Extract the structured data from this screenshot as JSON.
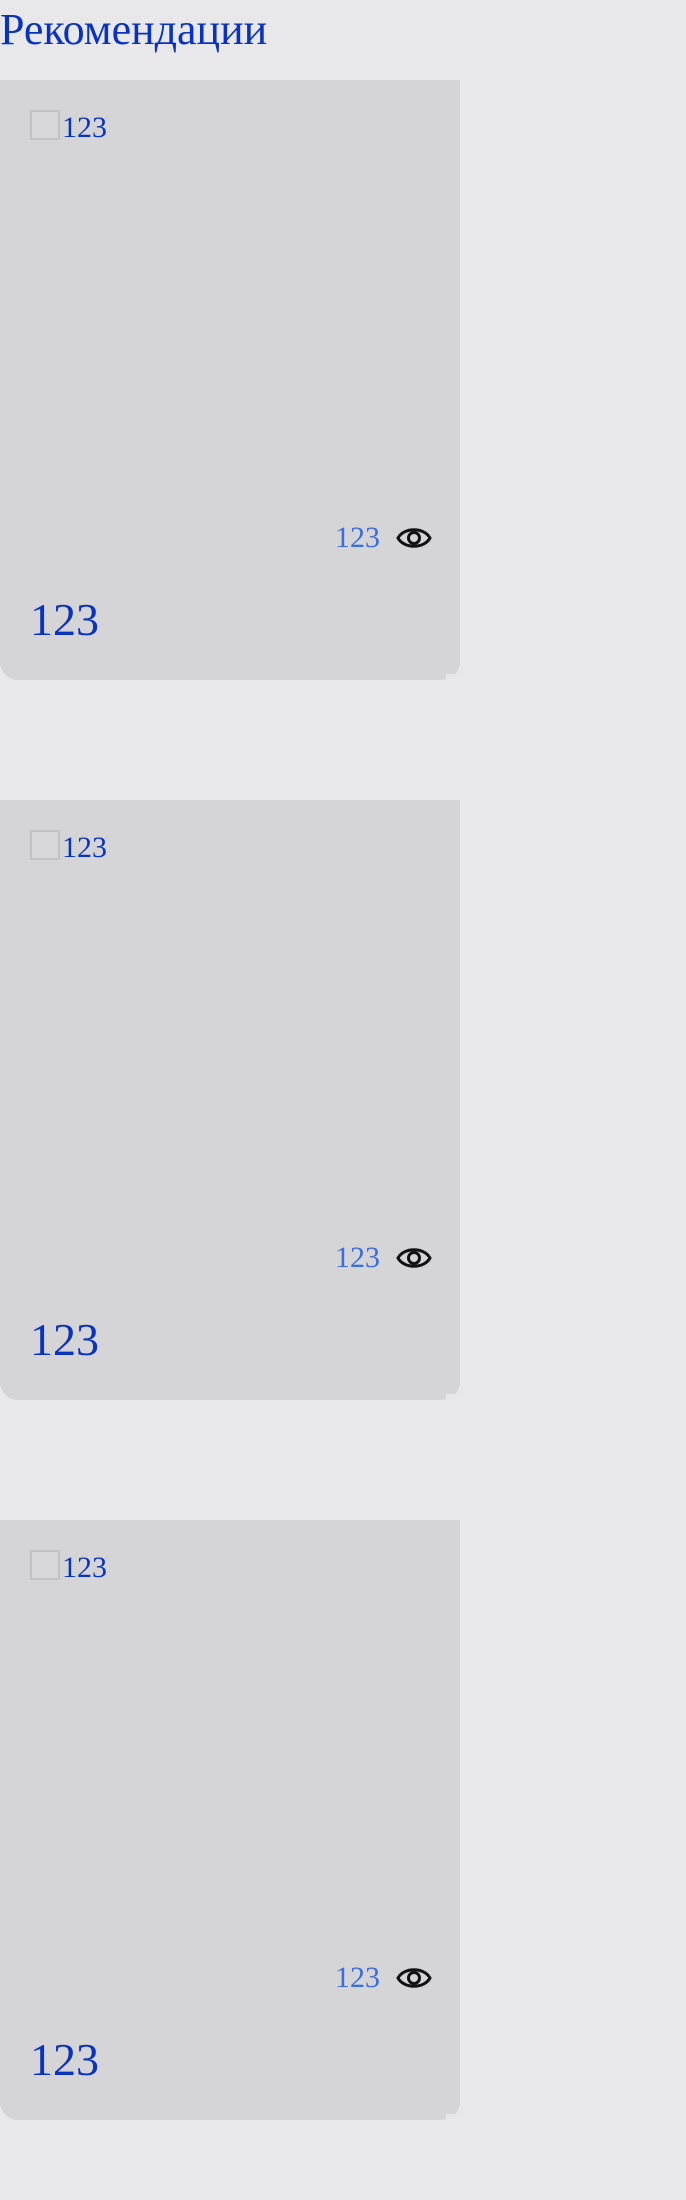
{
  "header": {
    "title": "Рекомендации"
  },
  "cards": [
    {
      "label": "123",
      "views": "123",
      "title": "123"
    },
    {
      "label": "123",
      "views": "123",
      "title": "123"
    },
    {
      "label": "123",
      "views": "123",
      "title": "123"
    }
  ],
  "colors": {
    "background": "#e8e8eb",
    "card": "#d5d5d8",
    "title_text": "#0a32c0",
    "views_text": "#3a6ee0"
  }
}
